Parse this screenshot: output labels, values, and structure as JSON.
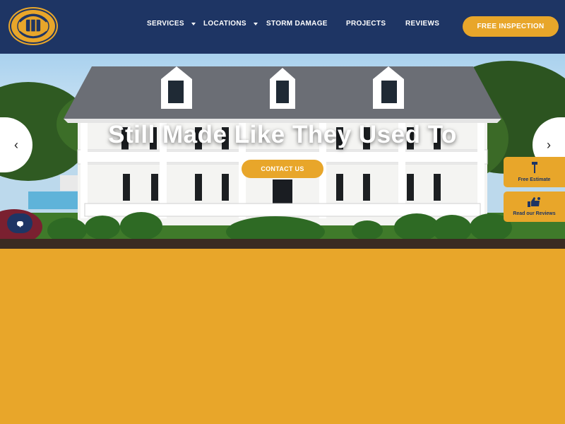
{
  "brand": {
    "logo_text": "AC MATTHEWS",
    "logo_subtext": "ROOFING & EXTERIORS"
  },
  "nav": {
    "items": [
      {
        "label": "SERVICES",
        "has_dropdown": true
      },
      {
        "label": "LOCATIONS",
        "has_dropdown": true
      },
      {
        "label": "STORM DAMAGE",
        "has_dropdown": false
      },
      {
        "label": "PROJECTS",
        "has_dropdown": false
      },
      {
        "label": "REVIEWS",
        "has_dropdown": false
      }
    ],
    "cta_label": "FREE INSPECTION"
  },
  "hero": {
    "title": "Still Made Like They Used To",
    "contact_label": "CONTACT US",
    "prev_arrow": "‹",
    "next_arrow": "›"
  },
  "side_tabs": {
    "estimate_label": "Free Estimate",
    "estimate_icon": "hammer-icon",
    "reviews_label": "Read our Reviews",
    "reviews_icon": "thumbs-up-icon"
  },
  "chat": {
    "icon": "chat-bubble-icon"
  },
  "colors": {
    "navy": "#1e3564",
    "gold": "#e8a62a",
    "white": "#ffffff"
  }
}
